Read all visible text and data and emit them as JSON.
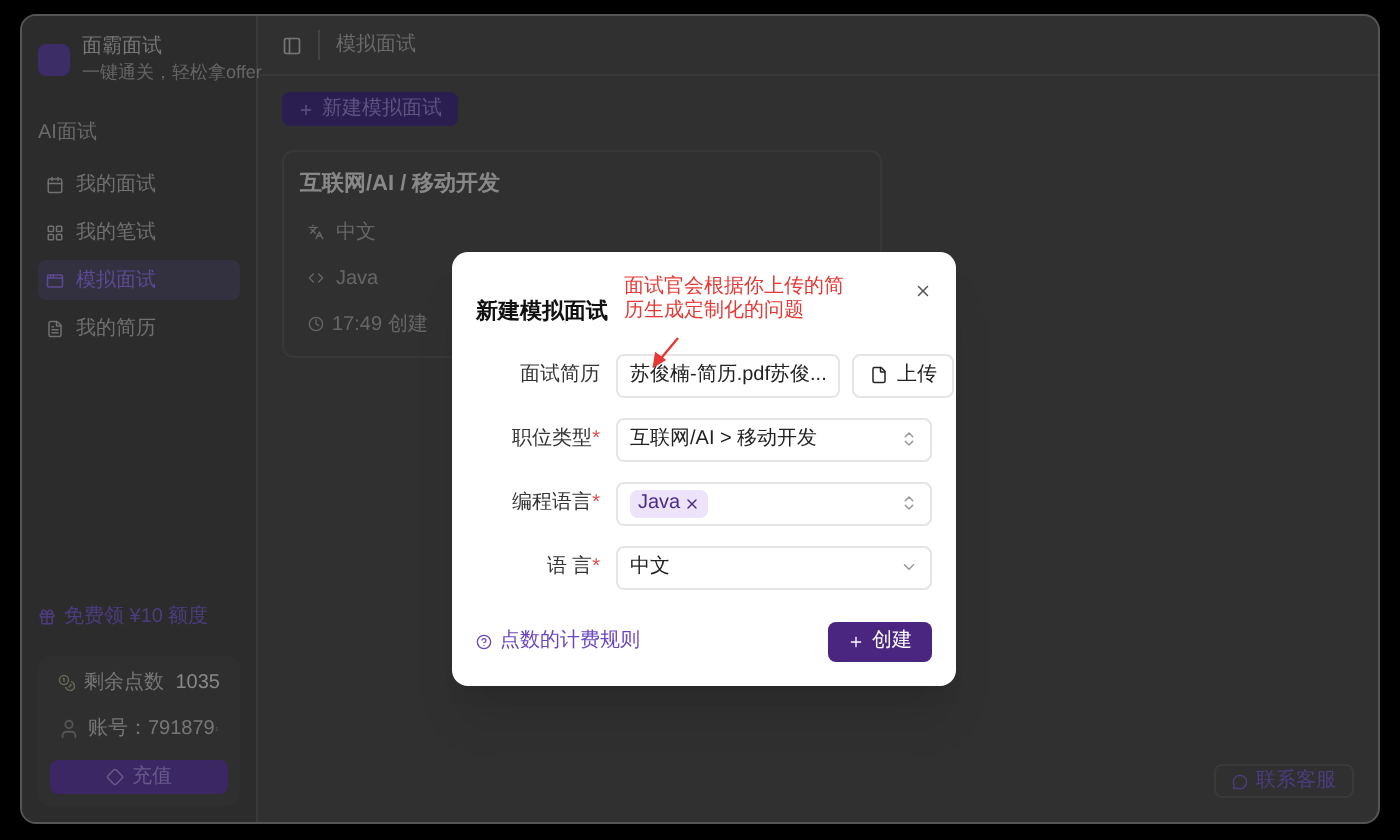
{
  "app": {
    "name": "面霸面试",
    "tagline": "一键通关，轻松拿offer"
  },
  "sidebar": {
    "section": "AI面试",
    "items": [
      {
        "label": "我的面试",
        "selected": false
      },
      {
        "label": "我的笔试",
        "selected": false
      },
      {
        "label": "模拟面试",
        "selected": true
      },
      {
        "label": "我的简历",
        "selected": false
      }
    ]
  },
  "promo": "免费领 ¥10 额度",
  "points": {
    "label": "剩余点数",
    "value": "1035"
  },
  "account": {
    "label": "账号：791879"
  },
  "recharge_button": "充值",
  "header": {
    "breadcrumb": "模拟面试"
  },
  "new_button": "新建模拟面试",
  "card": {
    "title": "互联网/AI / 移动开发",
    "tags": [
      {
        "label": "中文"
      },
      {
        "label": "Java"
      }
    ],
    "footer": "17:49 创建"
  },
  "support_button": "联系客服",
  "modal": {
    "title": "新建模拟面试",
    "annotation": "面试官会根据你上传的简历生成定制化的问题",
    "fields": [
      {
        "kind": "file",
        "label": "面试简历",
        "value": "苏俊楠-简历.pdf苏俊...",
        "button": "上传"
      },
      {
        "kind": "combobox",
        "label": "职位类型",
        "mark": "*",
        "value": "互联网/AI > 移动开发"
      },
      {
        "kind": "tags",
        "label": "编程语言",
        "mark": "*",
        "tags": [
          "Java"
        ]
      },
      {
        "kind": "select",
        "label": "语 言",
        "mark": "*",
        "value": "中文"
      }
    ],
    "help_link": "点数的计费规则",
    "submit": "创建"
  }
}
